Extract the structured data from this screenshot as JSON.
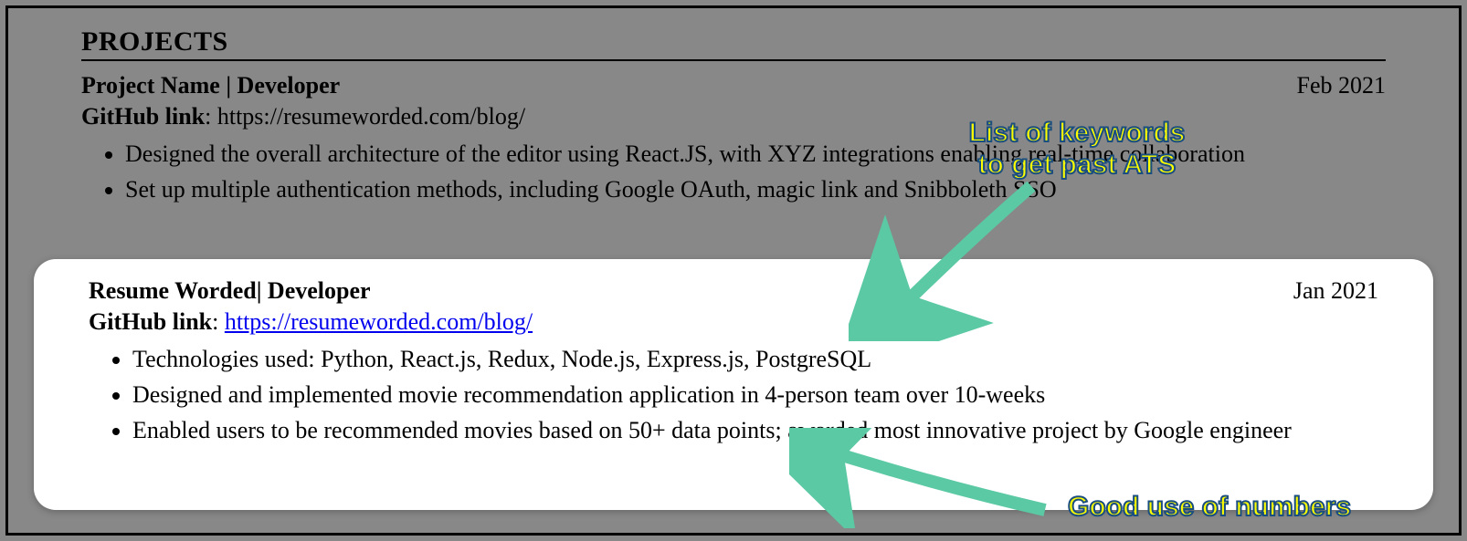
{
  "section_title": "PROJECTS",
  "project1": {
    "title": "Project Name | Developer",
    "date": "Feb 2021",
    "github_label": "GitHub link",
    "github_url": "https://resumeworded.com/blog/",
    "bullets": [
      "Designed the overall architecture of the editor using React.JS, with XYZ integrations enabling real-time collaboration",
      "Set up multiple authentication methods, including Google OAuth, magic link and Snibboleth SSO"
    ]
  },
  "project2": {
    "title": "Resume Worded| Developer",
    "date": "Jan 2021",
    "github_label": "GitHub link",
    "github_url": "https://resumeworded.com/blog/",
    "bullets": [
      "Technologies used: Python, React.js, Redux, Node.js, Express.js, PostgreSQL",
      "Designed and implemented movie recommendation application in 4-person team over 10-weeks",
      "Enabled users to be recommended movies based on 50+ data points; awarded most innovative project by Google engineer"
    ]
  },
  "callouts": {
    "top": "List of keywords\nto get past ATS",
    "bottom": "Good use of numbers"
  }
}
